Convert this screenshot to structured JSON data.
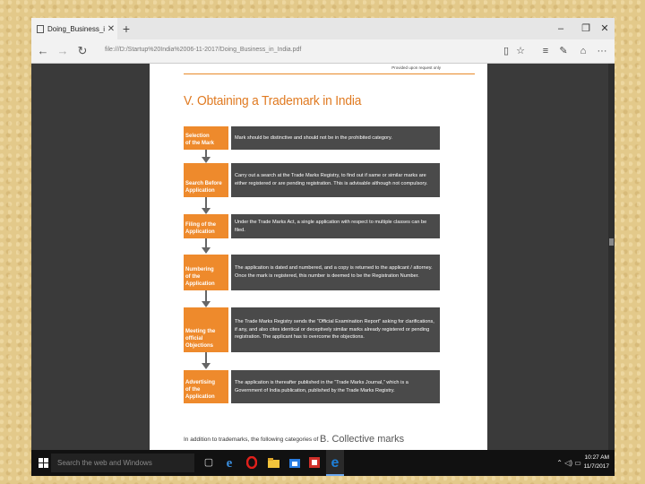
{
  "browser": {
    "tab_title": "Doing_Business_in_India",
    "tab_close": "✕",
    "new_tab": "+",
    "minimize": "–",
    "restore": "❐",
    "close": "✕",
    "back": "←",
    "forward": "→",
    "refresh": "↻",
    "url": "file:///D:/Startup%20India%2006-11-2017/Doing_Business_in_India.pdf",
    "toolbar_icons": [
      "reading-view-icon",
      "favorite-star-icon",
      "hub-icon",
      "web-note-icon",
      "share-icon",
      "more-icon"
    ],
    "toolbar_glyphs": [
      "▯",
      "☆",
      "≡",
      "✎",
      "⌂",
      "···"
    ]
  },
  "pdf": {
    "top_note": "Provided upon request only",
    "heading": "V. Obtaining a Trademark in India",
    "steps": [
      {
        "label_1": "Selection",
        "label_2": "of the Mark",
        "text": "Mark should be distinctive and should not be in the prohibited category."
      },
      {
        "label_1": "Search Before",
        "label_2": "Application",
        "text": "Carry out a search at the Trade Marks Registry, to find out if same or similar marks are either registered or  are pending registration. This is advisable although not compulsory."
      },
      {
        "label_1": "Filing of the",
        "label_2": "Application",
        "text": "Under the Trade Marks Act, a single application with respect to multiple classes can be filed."
      },
      {
        "label_1": "Numbering",
        "label_2": "of the Application",
        "text": "The application is dated and numbered, and a copy is returned to the applicant / attorney. Once the mark is registered, this number is deemed to be the Registration Number."
      },
      {
        "label_1": "Meeting the",
        "label_2": "official Objections",
        "text": "The Trade Marks Registry sends the “Official Examination Report” asking for clarifications, if any, and also cites identical or deceptively similar marks already registered or pending registration. The applicant has to overcome the objections."
      },
      {
        "label_1": "Advertising",
        "label_2": "of the Application",
        "text": "The application is thereafter published in the “Trade Marks Journal,” which is a Government of India publication, published by the Trade Marks Registry."
      }
    ],
    "footer_left": "In addition to trademarks, the following categories of",
    "footer_right": "B. Collective marks"
  },
  "taskbar": {
    "search_placeholder": "Search the web and Windows",
    "time": "10:27 AM",
    "date": "11/7/2017",
    "colors": {
      "opera": "#e0201b",
      "edge": "#1e7fd8",
      "explorer": "#f3c53c",
      "store": "#2a7de1",
      "pdf": "#d0302a"
    }
  }
}
